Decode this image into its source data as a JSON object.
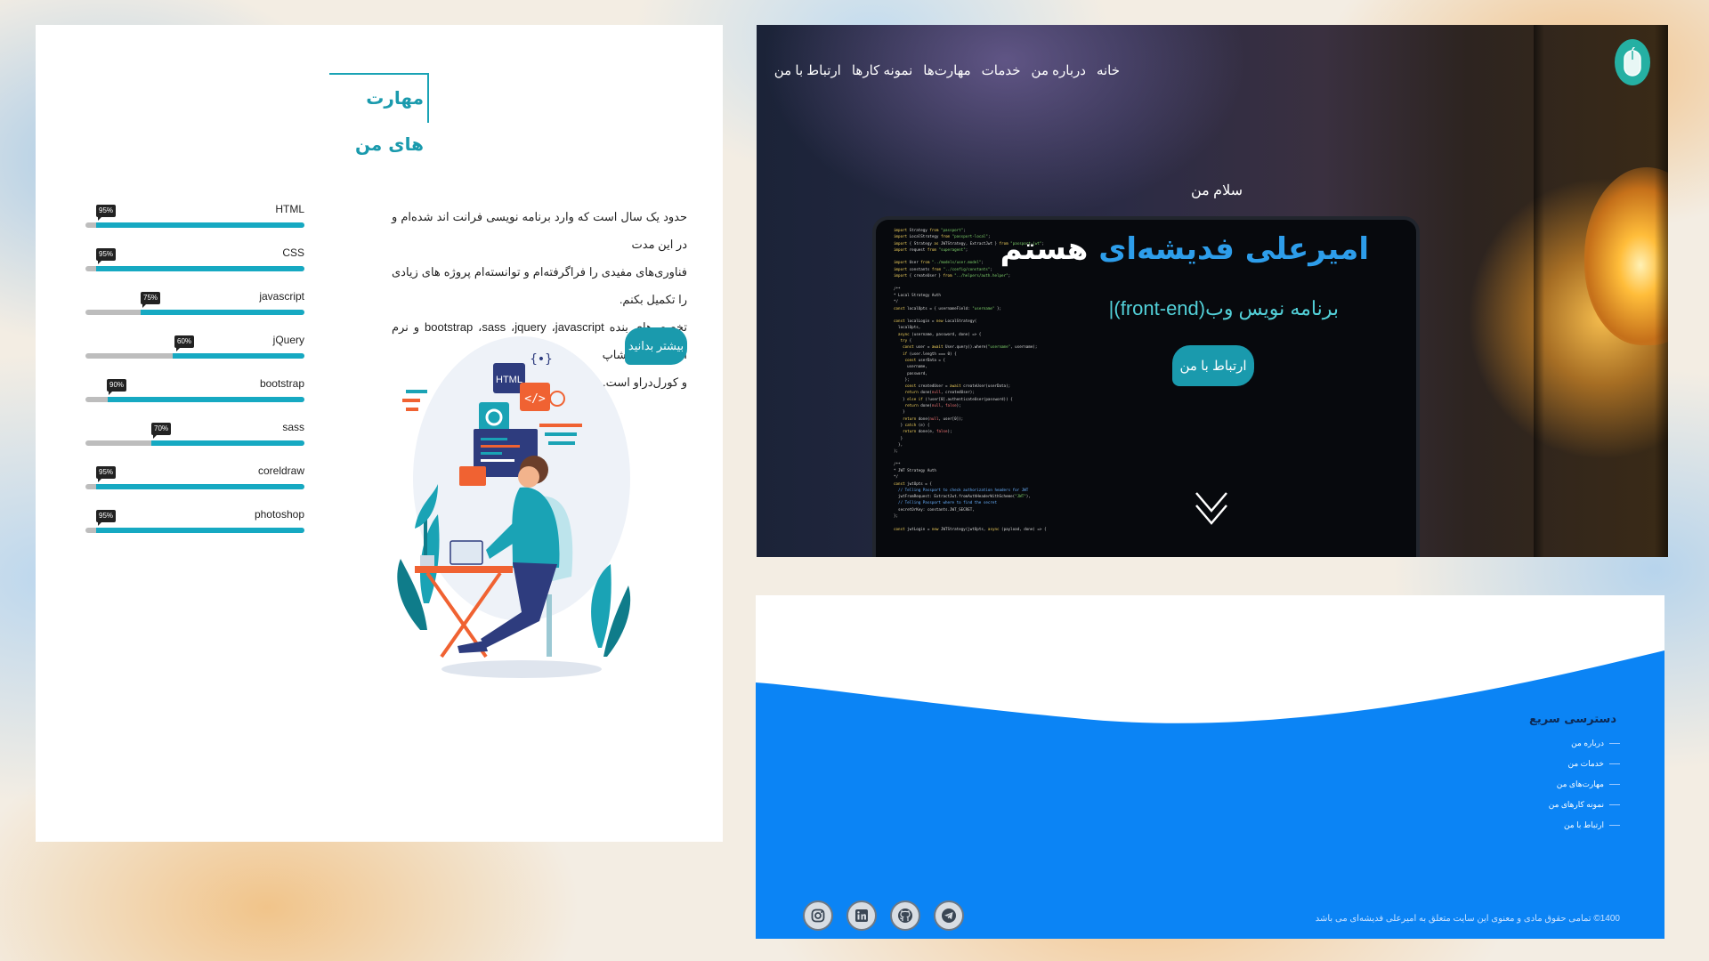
{
  "skills_section": {
    "title": "مهارت های من",
    "paragraph_line1": "حدود یک سال است که وارد برنامه نویسی فرانت اند شده‌ام و در این مدت",
    "paragraph_line2": "فناوری‌های مفیدی را فراگرفته‌ام و توانسته‌ام پروژه های زیادی را تکمیل بکنم.",
    "paragraph_line3": "تخصص‌های بنده bootstrap ،sass ،jquery ،javascript و نرم افزارهای فتوشاپ",
    "paragraph_line4": "و کورل‌دراو است.",
    "more_button": "بیشتر بدانید",
    "skills": [
      {
        "name": "HTML",
        "percent_label": "95%",
        "level": 95
      },
      {
        "name": "CSS",
        "percent_label": "95%",
        "level": 95
      },
      {
        "name": "javascript",
        "percent_label": "75%",
        "level": 75
      },
      {
        "name": "jQuery",
        "percent_label": "60%",
        "level": 60
      },
      {
        "name": "bootstrap",
        "percent_label": "90%",
        "level": 90
      },
      {
        "name": "sass",
        "percent_label": "70%",
        "level": 70
      },
      {
        "name": "coreldraw",
        "percent_label": "95%",
        "level": 95
      },
      {
        "name": "photoshop",
        "percent_label": "95%",
        "level": 95
      }
    ],
    "illustration_labels": {
      "html_card": "HTML",
      "braces": "{•}"
    }
  },
  "hero": {
    "nav": [
      {
        "label": "خانه"
      },
      {
        "label": "درباره من"
      },
      {
        "label": "خدمات"
      },
      {
        "label": "مهارت‌ها"
      },
      {
        "label": "نمونه کارها"
      },
      {
        "label": "ارتباط با من"
      }
    ],
    "greeting": "سلام من",
    "name_highlight": "امیرعلی فدیشه‌ای",
    "name_suffix": "هستم",
    "role": "برنامه نویس وب(front-end)|",
    "contact_button": "ارتباط با من",
    "colors": {
      "accent": "#1a9aad",
      "name_blue": "#2d9dea",
      "role_cyan": "#52d0d8"
    }
  },
  "footer": {
    "quick_access_title": "دسترسی سریع",
    "links": [
      {
        "label": "درباره من"
      },
      {
        "label": "خدمات من"
      },
      {
        "label": "مهارت‌های من"
      },
      {
        "label": "نمونه کارهای من"
      },
      {
        "label": "ارتباط با من"
      }
    ],
    "copyright": "1400© تمامی حقوق مادی و معنوی این سایت متعلق به امیرعلی فدیشه‌ای می باشد",
    "socials": [
      "instagram-icon",
      "linkedin-icon",
      "github-icon",
      "telegram-icon"
    ],
    "colors": {
      "background": "#0b84f5"
    }
  }
}
